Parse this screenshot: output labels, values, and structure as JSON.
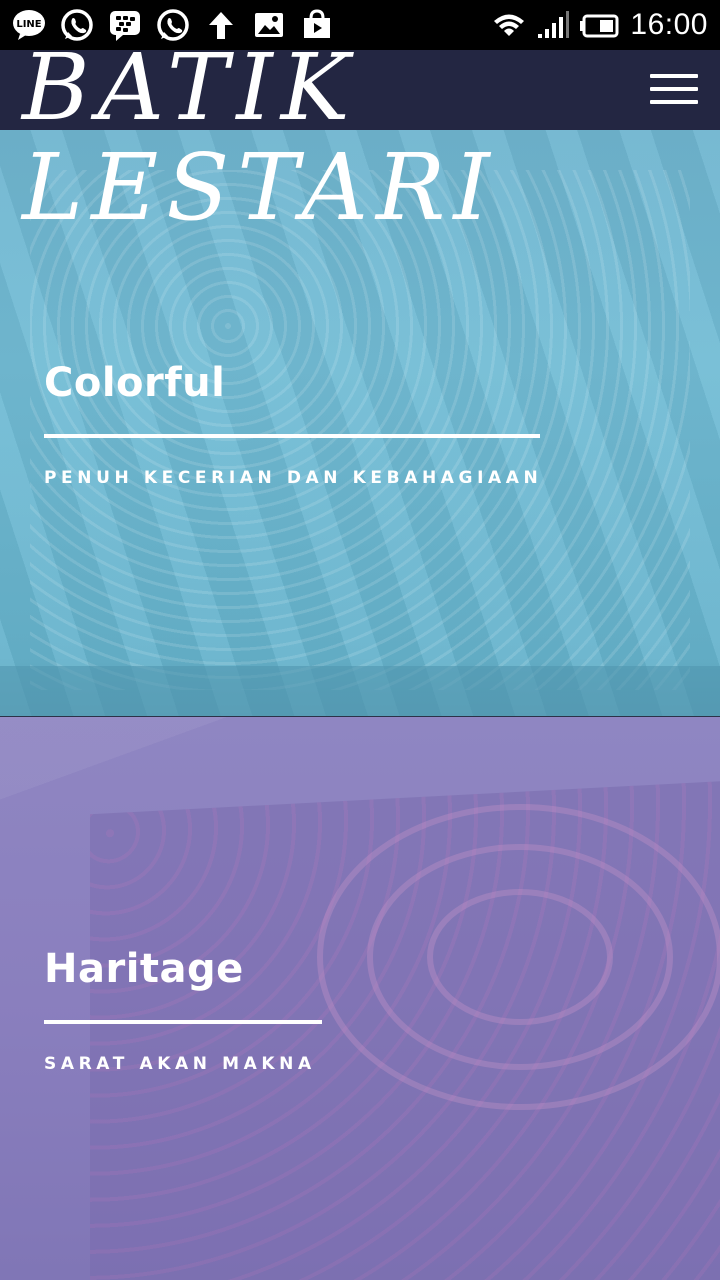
{
  "status_bar": {
    "left_icons": [
      "line-icon",
      "whatsapp-icon",
      "blackberry-messenger-icon",
      "whatsapp-icon",
      "upload-arrow-icon",
      "gallery-icon",
      "play-store-icon"
    ],
    "right_icons": [
      "wifi-icon",
      "signal-icon",
      "battery-icon"
    ],
    "time": "16:00"
  },
  "header": {
    "brand_line1": "BATIK",
    "brand_line2": "LESTARI",
    "menu_icon": "hamburger-menu-icon"
  },
  "panels": [
    {
      "title": "Colorful",
      "subtitle": "PENUH KECERIAN DAN KEBAHAGIAAN",
      "tint": "#6fb5cf"
    },
    {
      "title": "Haritage",
      "subtitle": "SARAT AKAN MAKNA",
      "tint": "#8a7fbe"
    }
  ],
  "colors": {
    "navbar": "#232642",
    "text": "#ffffff"
  }
}
